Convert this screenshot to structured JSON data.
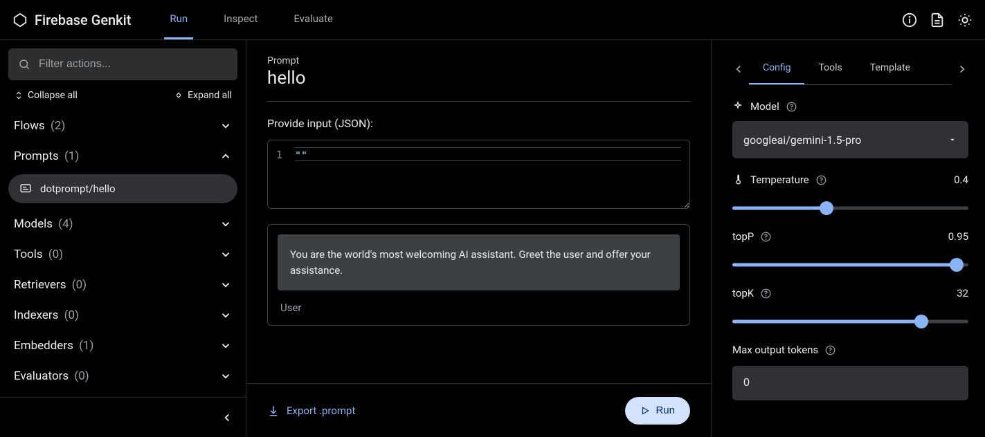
{
  "brand": "Firebase Genkit",
  "top_tabs": [
    "Run",
    "Inspect",
    "Evaluate"
  ],
  "top_tabs_active": 0,
  "sidebar": {
    "search_placeholder": "Filter actions...",
    "collapse_label": "Collapse all",
    "expand_label": "Expand all",
    "categories": [
      {
        "name": "Flows",
        "count": "(2)",
        "expanded": false
      },
      {
        "name": "Prompts",
        "count": "(1)",
        "expanded": true,
        "items": [
          "dotprompt/hello"
        ]
      },
      {
        "name": "Models",
        "count": "(4)",
        "expanded": false
      },
      {
        "name": "Tools",
        "count": "(0)",
        "expanded": false
      },
      {
        "name": "Retrievers",
        "count": "(0)",
        "expanded": false
      },
      {
        "name": "Indexers",
        "count": "(0)",
        "expanded": false
      },
      {
        "name": "Embedders",
        "count": "(1)",
        "expanded": false
      },
      {
        "name": "Evaluators",
        "count": "(0)",
        "expanded": false
      }
    ]
  },
  "main": {
    "crumb": "Prompt",
    "title": "hello",
    "input_label": "Provide input (JSON):",
    "code_gutter": "1",
    "code_content": "\"\"",
    "message_text": "You are the world's most welcoming AI assistant. Greet the user and offer your assistance.",
    "message_role": "User",
    "export_label": "Export .prompt",
    "run_label": "Run"
  },
  "right": {
    "tabs": [
      "Config",
      "Tools",
      "Template"
    ],
    "tabs_active": 0,
    "model_label": "Model",
    "model_value": "googleai/gemini-1.5-pro",
    "temperature_label": "Temperature",
    "temperature_value": "0.4",
    "temperature_pct": 40,
    "topp_label": "topP",
    "topp_value": "0.95",
    "topp_pct": 95,
    "topk_label": "topK",
    "topk_value": "32",
    "topk_pct": 80,
    "max_tokens_label": "Max output tokens",
    "max_tokens_value": "0"
  }
}
